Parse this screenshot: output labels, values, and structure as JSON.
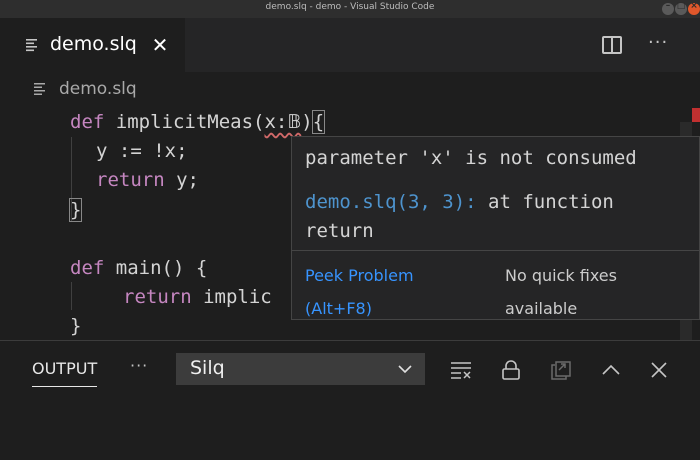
{
  "window": {
    "title": "demo.slq - demo - Visual Studio Code"
  },
  "tab": {
    "label": "demo.slq",
    "close": "✕"
  },
  "breadcrumb": {
    "file": "demo.slq"
  },
  "editor": {
    "lines": [
      {
        "kw": "def",
        "rest_a": " implicitMeas(",
        "param": "x:𝔹",
        "rest_b": ")",
        "brace": "{"
      },
      {
        "text": "y := !x;"
      },
      {
        "kw": "return",
        "rest": " y;"
      },
      {
        "brace": "}"
      },
      {
        "kw": "def",
        "rest": " main() {"
      },
      {
        "kw": "return",
        "rest": " implic"
      },
      {
        "brace": "}"
      }
    ]
  },
  "hover": {
    "message": "parameter 'x' is not consumed",
    "location_link": "demo.slq(3, 3):",
    "location_text": " at function return",
    "peek_label": "Peek Problem (Alt+F8)",
    "no_fixes": "No quick fixes available"
  },
  "panel": {
    "tab_label": "OUTPUT",
    "more": "···",
    "selected_channel": "Silq"
  },
  "colors": {
    "keyword": "#c586c0",
    "link": "#3794ff",
    "error": "#d16969",
    "close_button": "#e0572b"
  },
  "icons": {
    "file": "file-lines-icon",
    "split": "split-editor-icon",
    "more": "more-actions-icon",
    "clear": "clear-output-icon",
    "lock": "lock-icon",
    "open_log": "open-log-icon",
    "maximize": "chevron-up-icon",
    "close": "close-icon"
  }
}
